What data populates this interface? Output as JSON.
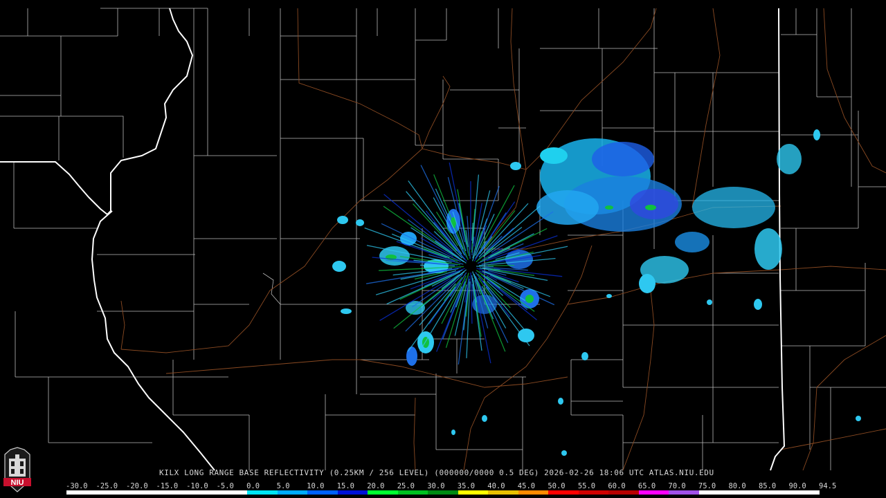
{
  "product_title": "KILX LONG RANGE BASE REFLECTIVITY (0.25KM / 256 LEVEL) (000000/0000 0.5 DEG) 2026-02-26 18:06 UTC  ATLAS.NIU.EDU",
  "logo_text": "NIU",
  "icons": [
    "niu-logo-icon"
  ],
  "colors": {
    "background": "#000000",
    "county_line": "#b9b9b9",
    "state_line": "#ffffff",
    "road": "#8a4a22"
  },
  "scale": {
    "labels": [
      "-30.0",
      "-25.0",
      "-20.0",
      "-15.0",
      "-10.0",
      "-5.0",
      "0.0",
      "5.0",
      "10.0",
      "15.0",
      "20.0",
      "25.0",
      "30.0",
      "35.0",
      "40.0",
      "45.0",
      "50.0",
      "55.0",
      "60.0",
      "65.0",
      "70.0",
      "75.0",
      "80.0",
      "85.0",
      "90.0",
      "94.5"
    ],
    "colors": [
      "#ffffff",
      "#ffffff",
      "#ffffff",
      "#ffffff",
      "#ffffff",
      "#ffffff",
      "#00e4f4",
      "#00aaff",
      "#0060ff",
      "#0010d8",
      "#00ff30",
      "#00c020",
      "#008a12",
      "#ffff00",
      "#e8c000",
      "#ff8a00",
      "#ff0000",
      "#d00000",
      "#b80000",
      "#ff00ff",
      "#a050e8",
      "#ffffff",
      "#ffffff",
      "#ffffff",
      "#ffffff"
    ]
  }
}
